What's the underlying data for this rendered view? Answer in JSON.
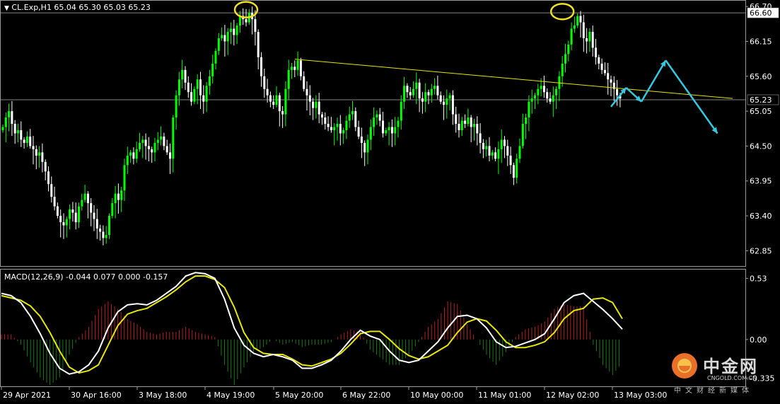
{
  "window": {
    "symbol_line": "CL.Exp,H1  65.04 65.30 65.03 65.23",
    "indicator_line": "MACD(12,26,9) -0.044 0.077 0.000 -0.157",
    "current_price_label": "65.23",
    "resistance_label": "66.60"
  },
  "watermark": {
    "name": "中金网",
    "url": "CNGOLD.COM.CN",
    "tagline": "中文财经新媒体"
  },
  "colors": {
    "background": "#000000",
    "bull": "#00ff00",
    "bear": "#ffffff",
    "trendline": "#e6e600",
    "annotation": "#34c8e0",
    "macd_line": "#ffffff",
    "signal_line": "#e6e600",
    "hist_pos": "#b22222",
    "hist_neg": "#1a7a1a"
  },
  "chart_data": [
    {
      "type": "candlestick",
      "title": "",
      "y_ticks": [
        "66.70",
        "66.15",
        "65.60",
        "65.05",
        "64.50",
        "63.95",
        "63.40",
        "62.85"
      ],
      "ylim": [
        62.62,
        66.78
      ],
      "x_ticks": [
        "29 Apr 2021",
        "30 Apr 16:00",
        "3 May 18:00",
        "4 May 19:00",
        "5 May 20:00",
        "6 May 22:00",
        "10 May 00:00",
        "11 May 01:00",
        "12 May 02:00",
        "13 May 03:00"
      ],
      "horizontal_lines": [
        66.6,
        65.23
      ],
      "trendline": [
        {
          "bar": 96,
          "price": 65.87
        },
        {
          "bar": 240,
          "price": 65.25
        }
      ],
      "resistance_circles": [
        {
          "bar": 80,
          "price": 66.65
        },
        {
          "bar": 184,
          "price": 66.62
        }
      ],
      "forecast_path": [
        {
          "bar": 200,
          "price": 65.12
        },
        {
          "bar": 205,
          "price": 65.42
        },
        {
          "bar": 210,
          "price": 65.2
        },
        {
          "bar": 218,
          "price": 65.85
        },
        {
          "bar": 235,
          "price": 64.7
        }
      ],
      "close_series": [
        64.8,
        64.95,
        65.05,
        64.85,
        64.7,
        64.75,
        64.6,
        64.55,
        64.65,
        64.5,
        64.45,
        64.35,
        64.4,
        64.25,
        64.1,
        63.9,
        63.7,
        63.55,
        63.4,
        63.3,
        63.25,
        63.35,
        63.5,
        63.45,
        63.3,
        63.55,
        63.65,
        63.75,
        63.6,
        63.45,
        63.35,
        63.2,
        63.15,
        63.05,
        63.1,
        63.4,
        63.6,
        63.75,
        63.65,
        63.8,
        64.2,
        64.35,
        64.4,
        64.3,
        64.45,
        64.55,
        64.6,
        64.5,
        64.45,
        64.4,
        64.55,
        64.6,
        64.65,
        64.5,
        64.4,
        64.3,
        64.95,
        65.3,
        65.55,
        65.7,
        65.5,
        65.35,
        65.2,
        65.4,
        65.55,
        65.3,
        65.2,
        65.45,
        65.6,
        65.8,
        66.0,
        66.2,
        66.25,
        66.15,
        66.3,
        66.35,
        66.25,
        66.4,
        66.55,
        66.5,
        66.45,
        66.6,
        66.5,
        66.3,
        65.9,
        65.6,
        65.4,
        65.3,
        65.2,
        65.15,
        65.3,
        65.05,
        65.0,
        65.4,
        65.7,
        65.75,
        65.7,
        65.85,
        65.6,
        65.4,
        65.3,
        65.2,
        65.1,
        65.2,
        65.0,
        64.95,
        64.85,
        64.8,
        64.75,
        64.8,
        64.85,
        64.7,
        64.75,
        64.9,
        65.0,
        65.05,
        64.8,
        64.65,
        64.55,
        64.4,
        64.6,
        64.8,
        64.95,
        65.0,
        64.9,
        64.7,
        64.75,
        64.8,
        64.7,
        64.8,
        64.9,
        65.2,
        65.45,
        65.35,
        65.3,
        65.4,
        65.5,
        65.25,
        65.2,
        65.35,
        65.3,
        65.4,
        65.45,
        65.3,
        65.2,
        65.15,
        65.25,
        65.3,
        65.0,
        64.85,
        64.75,
        64.9,
        64.85,
        64.95,
        64.8,
        64.85,
        64.7,
        64.55,
        64.45,
        64.5,
        64.35,
        64.4,
        64.3,
        64.45,
        64.6,
        64.5,
        64.35,
        64.2,
        64.0,
        64.3,
        64.5,
        64.85,
        64.95,
        65.2,
        65.25,
        65.3,
        65.4,
        65.45,
        65.35,
        65.25,
        65.2,
        65.3,
        65.4,
        65.6,
        65.8,
        65.95,
        66.1,
        66.35,
        66.4,
        66.55,
        66.45,
        66.2,
        66.15,
        66.3,
        66.05,
        65.9,
        65.8,
        65.7,
        65.65,
        65.55,
        65.5,
        65.4,
        65.3,
        65.25
      ]
    },
    {
      "type": "macd",
      "title": "MACD(12,26,9)",
      "y_ticks": [
        "0.53",
        "0.00",
        "-0.335"
      ],
      "ylim": [
        -0.4,
        0.6
      ],
      "macd": [
        0.4,
        0.38,
        0.32,
        0.2,
        0.05,
        -0.12,
        -0.25,
        -0.3,
        -0.28,
        -0.22,
        -0.1,
        0.1,
        0.24,
        0.3,
        0.31,
        0.3,
        0.34,
        0.4,
        0.46,
        0.55,
        0.58,
        0.57,
        0.53,
        0.35,
        0.1,
        -0.05,
        -0.12,
        -0.15,
        -0.13,
        -0.15,
        -0.18,
        -0.25,
        -0.25,
        -0.22,
        -0.18,
        -0.1,
        0.0,
        0.08,
        0.03,
        0.0,
        -0.1,
        -0.18,
        -0.2,
        -0.18,
        -0.1,
        -0.02,
        0.1,
        0.2,
        0.21,
        0.18,
        0.1,
        -0.02,
        -0.07,
        -0.06,
        -0.03,
        0.0,
        0.05,
        0.18,
        0.32,
        0.38,
        0.4,
        0.33,
        0.26,
        0.18,
        0.09
      ],
      "signal": [
        0.38,
        0.36,
        0.34,
        0.29,
        0.2,
        0.06,
        -0.1,
        -0.24,
        -0.29,
        -0.27,
        -0.22,
        -0.05,
        0.12,
        0.22,
        0.25,
        0.27,
        0.32,
        0.37,
        0.43,
        0.5,
        0.55,
        0.55,
        0.52,
        0.45,
        0.28,
        0.06,
        -0.07,
        -0.12,
        -0.13,
        -0.13,
        -0.17,
        -0.22,
        -0.23,
        -0.2,
        -0.17,
        -0.12,
        -0.04,
        0.05,
        0.07,
        0.07,
        0.0,
        -0.08,
        -0.14,
        -0.17,
        -0.15,
        -0.1,
        -0.05,
        0.06,
        0.15,
        0.18,
        0.16,
        0.08,
        -0.02,
        -0.07,
        -0.07,
        -0.05,
        -0.02,
        0.06,
        0.18,
        0.25,
        0.27,
        0.35,
        0.36,
        0.32,
        0.18
      ]
    }
  ]
}
